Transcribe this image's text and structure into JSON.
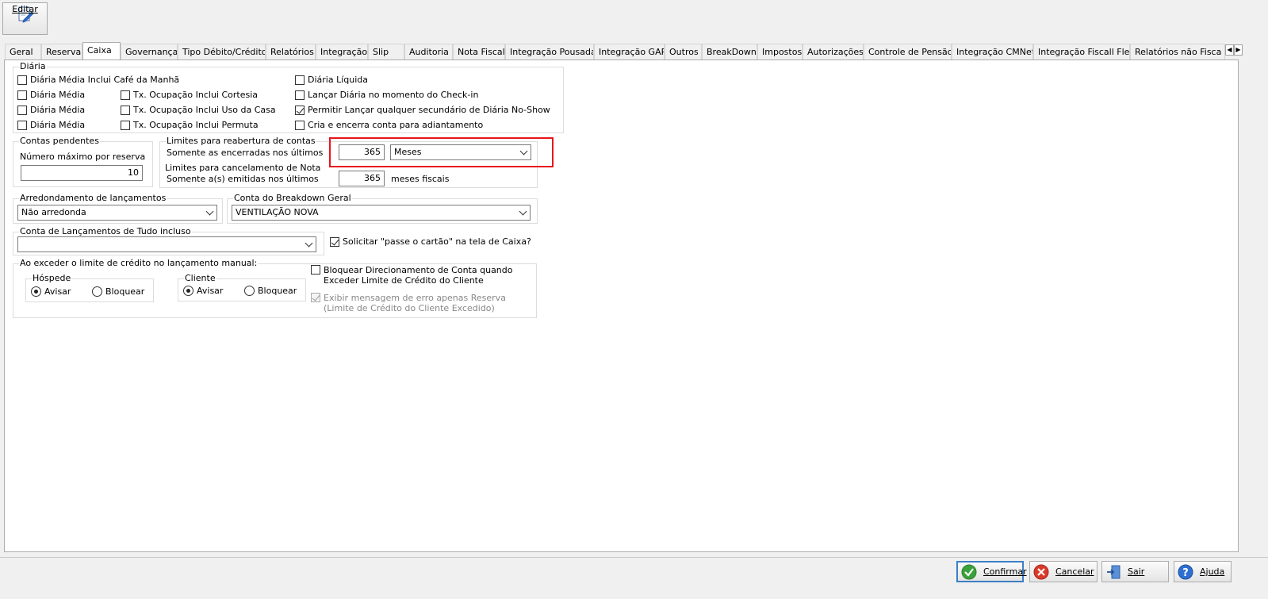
{
  "toolbar": {
    "edit_label": "Editar"
  },
  "tabs": [
    "Geral",
    "Reserva",
    "Caixa",
    "Governança",
    "Tipo Débito/Crédito",
    "Relatórios",
    "Integração",
    "Slip",
    "Auditoria",
    "Nota Fiscal",
    "Integração Pousada",
    "Integração GAP",
    "Outros",
    "BreakDown",
    "Impostos",
    "Autorizações",
    "Controle de Pensão",
    "Integração CMNet",
    "Integração Fiscall Flex",
    "Relatórios não Fisca"
  ],
  "active_tab": "Caixa",
  "diaria": {
    "title": "Diária",
    "cb_cafe": "Diária Média Inclui Café da Manhã",
    "cb_media1": "Diária Média",
    "cb_media2": "Diária Média",
    "cb_media3": "Diária Média",
    "cb_cortesia": "Tx. Ocupação Inclui Cortesia",
    "cb_uso_casa": "Tx. Ocupação Inclui Uso da Casa",
    "cb_permuta": "Tx. Ocupação Inclui Permuta",
    "cb_liquida": "Diária Líquida",
    "cb_checkin": "Lançar Diária no momento do Check-in",
    "cb_noshow": "Permitir Lançar qualquer secundário de Diária No-Show",
    "cb_adiantamento": "Cria e encerra conta para adiantamento"
  },
  "contas_pendentes": {
    "title": "Contas pendentes",
    "label": "Número máximo por reserva",
    "value": "10"
  },
  "limites_reabertura": {
    "title": "Limites para reabertura de contas",
    "label": "Somente as encerradas nos últimos",
    "value": "365",
    "unit": "Meses"
  },
  "limites_cancelamento": {
    "title": "Limites para cancelamento de Nota",
    "label": "Somente a(s) emitidas nos últimos",
    "value": "365",
    "unit": "meses fiscais"
  },
  "arredondamento": {
    "title": "Arredondamento de lançamentos",
    "value": "Não arredonda"
  },
  "breakdown": {
    "title": "Conta do Breakdown Geral",
    "value": "VENTILAÇÃO NOVA"
  },
  "tudo_incluso": {
    "title": "Conta de Lançamentos de Tudo incluso",
    "value": ""
  },
  "solicitar_passe": "Solicitar \"passe o cartão\" na tela de Caixa?",
  "limite_credito": {
    "title": "Ao exceder o limite de crédito no lançamento manual:",
    "hospede": {
      "title": "Hóspede",
      "avisar": "Avisar",
      "bloquear": "Bloquear"
    },
    "cliente": {
      "title": "Cliente",
      "avisar": "Avisar",
      "bloquear": "Bloquear"
    },
    "cb_bloquear": "Bloquear Direcionamento de Conta quando Exceder Limite de Crédito do Cliente",
    "cb_exibir": "Exibir mensagem de erro apenas Reserva (Limite de Crédito do Cliente Excedido)"
  },
  "buttons": {
    "confirmar": "Confirmar",
    "cancelar": "Cancelar",
    "sair": "Sair",
    "ajuda": "Ajuda"
  }
}
